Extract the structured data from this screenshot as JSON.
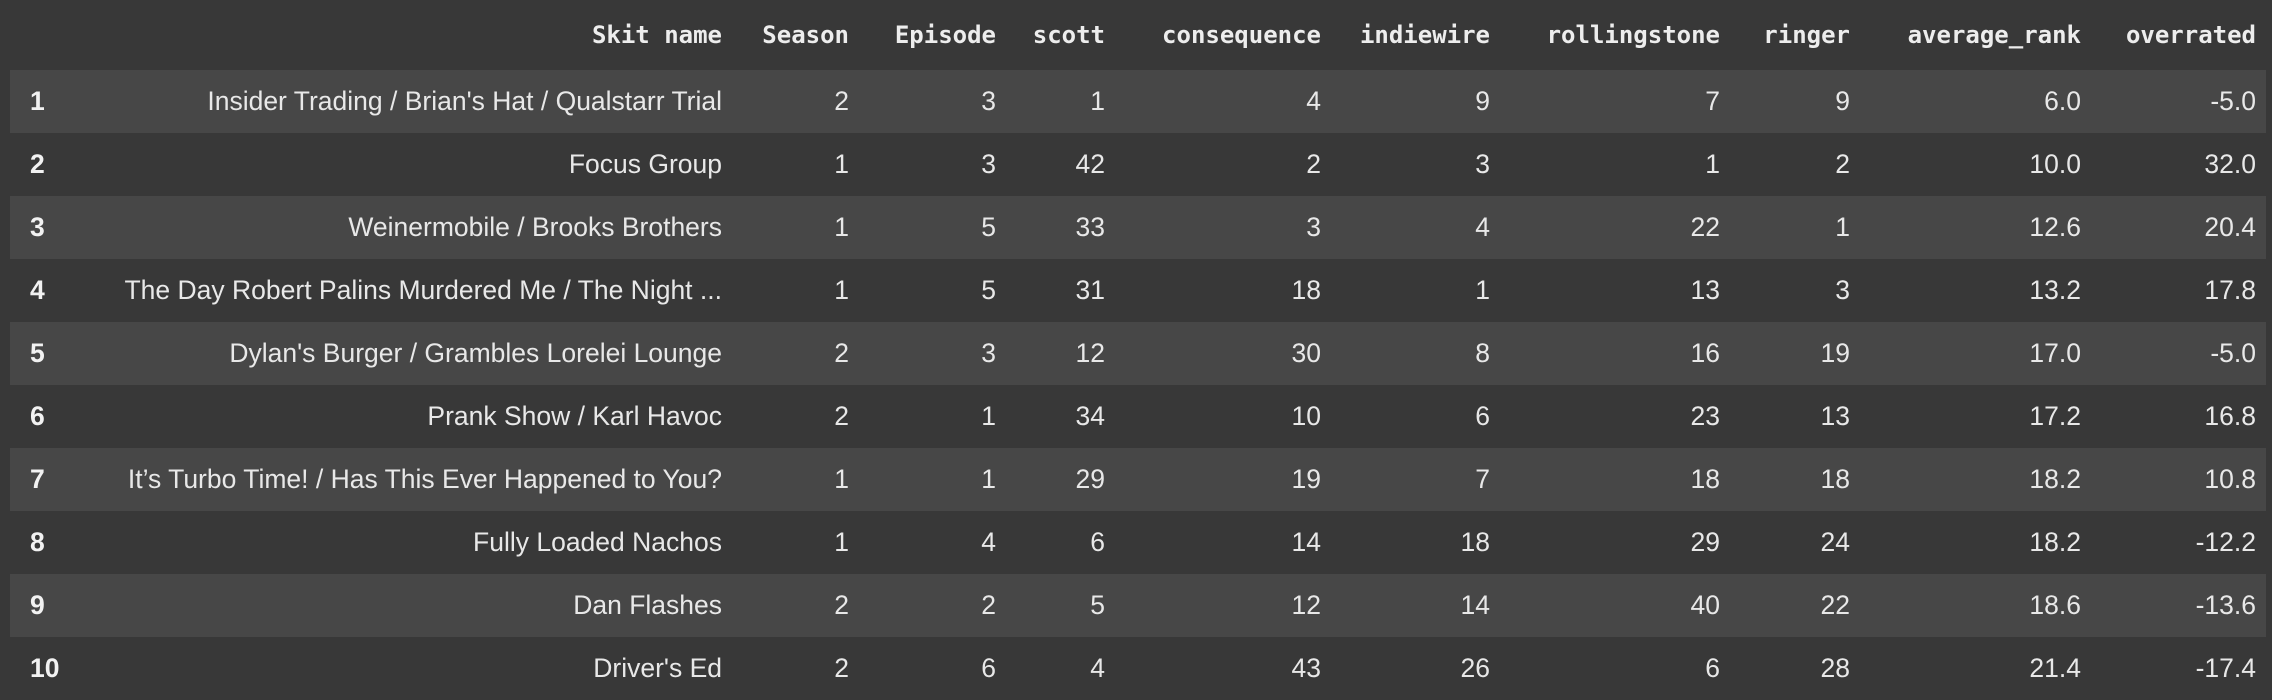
{
  "table": {
    "columns": [
      "",
      "Skit name",
      "Season",
      "Episode",
      "scott",
      "consequence",
      "indiewire",
      "rollingstone",
      "ringer",
      "average_rank",
      "overrated"
    ],
    "rows": [
      [
        "1",
        "Insider Trading / Brian's Hat / Qualstarr Trial",
        "2",
        "3",
        "1",
        "4",
        "9",
        "7",
        "9",
        "6.0",
        "-5.0"
      ],
      [
        "2",
        "Focus Group",
        "1",
        "3",
        "42",
        "2",
        "3",
        "1",
        "2",
        "10.0",
        "32.0"
      ],
      [
        "3",
        "Weinermobile / Brooks Brothers",
        "1",
        "5",
        "33",
        "3",
        "4",
        "22",
        "1",
        "12.6",
        "20.4"
      ],
      [
        "4",
        "The Day Robert Palins Murdered Me / The Night ...",
        "1",
        "5",
        "31",
        "18",
        "1",
        "13",
        "3",
        "13.2",
        "17.8"
      ],
      [
        "5",
        "Dylan's Burger / Grambles Lorelei Lounge",
        "2",
        "3",
        "12",
        "30",
        "8",
        "16",
        "19",
        "17.0",
        "-5.0"
      ],
      [
        "6",
        "Prank Show / Karl Havoc",
        "2",
        "1",
        "34",
        "10",
        "6",
        "23",
        "13",
        "17.2",
        "16.8"
      ],
      [
        "7",
        "It’s Turbo Time! / Has This Ever Happened to You?",
        "1",
        "1",
        "29",
        "19",
        "7",
        "18",
        "18",
        "18.2",
        "10.8"
      ],
      [
        "8",
        "Fully Loaded Nachos",
        "1",
        "4",
        "6",
        "14",
        "18",
        "29",
        "24",
        "18.2",
        "-12.2"
      ],
      [
        "9",
        "Dan Flashes",
        "2",
        "2",
        "5",
        "12",
        "14",
        "40",
        "22",
        "18.6",
        "-13.6"
      ],
      [
        "10",
        "Driver's Ed",
        "2",
        "6",
        "4",
        "43",
        "26",
        "6",
        "28",
        "21.4",
        "-17.4"
      ]
    ]
  }
}
